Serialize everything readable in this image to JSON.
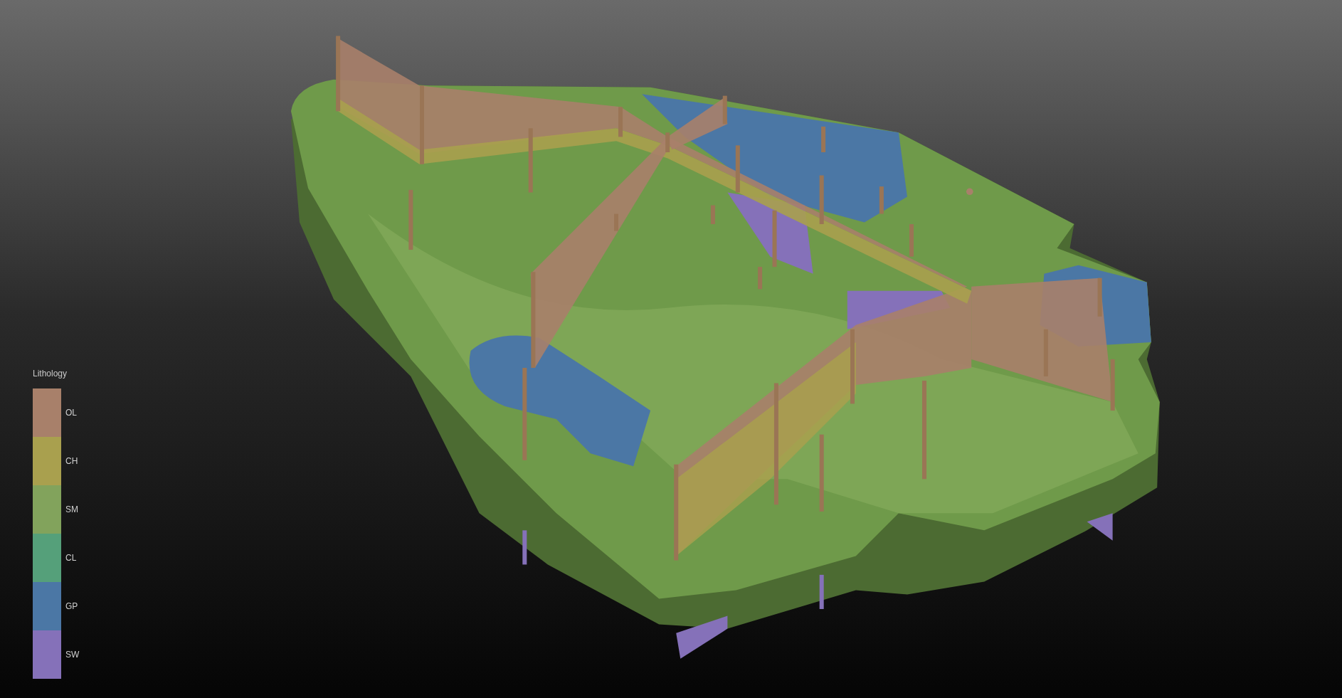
{
  "legend": {
    "title": "Lithology",
    "entries": [
      {
        "label": "OL",
        "color": "#a8806a"
      },
      {
        "label": "CH",
        "color": "#a9a04e"
      },
      {
        "label": "SM",
        "color": "#82a35c"
      },
      {
        "label": "CL",
        "color": "#55a07a"
      },
      {
        "label": "GP",
        "color": "#4b77a5"
      },
      {
        "label": "SW",
        "color": "#8571b9"
      }
    ]
  }
}
